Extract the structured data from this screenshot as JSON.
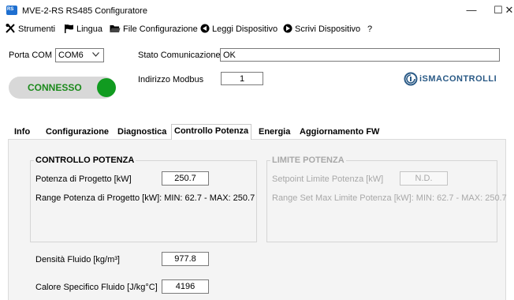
{
  "window": {
    "icon_text": "RS",
    "title": "MVE-2-RS RS485 Configuratore",
    "minimize": "—",
    "maximize": "☐",
    "close": "✕"
  },
  "menu": [
    {
      "label": "Strumenti",
      "icon": "tools-icon"
    },
    {
      "label": "Lingua",
      "icon": "flag-icon"
    },
    {
      "label": "File Configurazione",
      "icon": "folder-icon"
    },
    {
      "label": "Leggi Dispositivo",
      "icon": "read-device-icon"
    },
    {
      "label": "Scrivi Dispositivo",
      "icon": "write-device-icon"
    },
    {
      "label": "?",
      "icon": ""
    }
  ],
  "connection": {
    "port_label": "Porta COM",
    "port_value": "COM6",
    "status_label": "Stato Comunicazione",
    "status_value": "OK",
    "modbus_label": "Indirizzo Modbus",
    "modbus_value": "1",
    "toggle_label": "CONNESSO",
    "toggle_color": "#119b20"
  },
  "logo": {
    "brand": "iSMACONTROLLI",
    "color": "#2a5a86"
  },
  "tabs": [
    {
      "label": "Info",
      "active": false
    },
    {
      "label": "Configurazione",
      "active": false
    },
    {
      "label": "Diagnostica",
      "active": false
    },
    {
      "label": "Controllo Potenza",
      "active": true
    },
    {
      "label": "Energia",
      "active": false
    },
    {
      "label": "Aggiornamento FW",
      "active": false
    }
  ],
  "controllo_potenza": {
    "title": "CONTROLLO POTENZA",
    "design_power_label": "Potenza di Progetto [kW]",
    "design_power_value": "250.7",
    "range_text": "Range Potenza di Progetto [kW]: MIN: 62.7 - MAX: 250.7"
  },
  "limite_potenza": {
    "title": "LIMITE POTENZA",
    "setpoint_label": "Setpoint Limite Potenza [kW]",
    "setpoint_value": "N.D.",
    "range_text": "Range Set Max Limite Potenza [kW]: MIN: 62.7 - MAX: 250.7"
  },
  "fluid": {
    "density_label": "Densità Fluido [kg/m³]",
    "density_value": "977.8",
    "specific_heat_label": "Calore Specifico Fluido [J/kg°C]",
    "specific_heat_value": "4196"
  }
}
